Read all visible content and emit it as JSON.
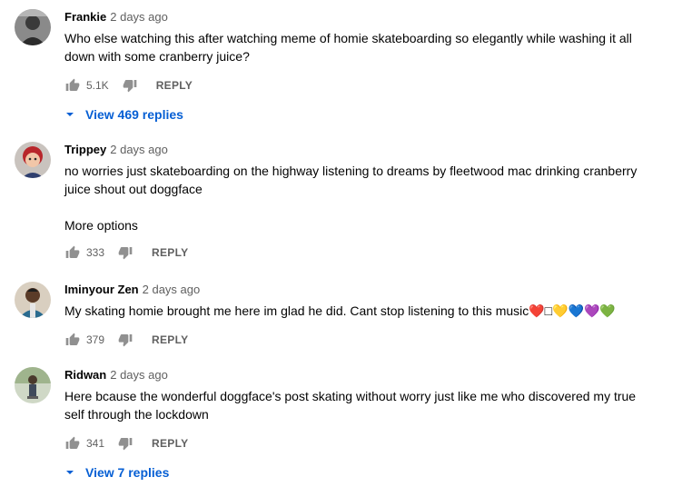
{
  "comments": [
    {
      "author": "Frankie",
      "time": "2 days ago",
      "lines": [
        "Who else watching this after watching meme of homie skateboarding so elegantly while washing it all",
        "down with some cranberry juice?"
      ],
      "likes": "5.1K",
      "reply_label": "REPLY",
      "view_replies": "View 469 replies"
    },
    {
      "author": "Trippey",
      "time": "2 days ago",
      "lines": [
        "no worries just skateboarding on the highway listening to dreams by fleetwood mac drinking cranberry",
        "juice shout out doggface"
      ],
      "more": "More options",
      "likes": "333",
      "reply_label": "REPLY"
    },
    {
      "author": "Iminyour Zen",
      "time": "2 days ago",
      "lines": [
        "My skating homie brought me here im glad he did. Cant stop listening to this music❤️□💛💙💜💚"
      ],
      "likes": "379",
      "reply_label": "REPLY"
    },
    {
      "author": "Ridwan",
      "time": "2 days ago",
      "lines": [
        "Here bcause the wonderful doggface's post skating without worry just like me who discovered my true",
        "self through the lockdown"
      ],
      "likes": "341",
      "reply_label": "REPLY",
      "view_replies": "View 7 replies"
    }
  ],
  "icons": {
    "like": "thumbs-up-icon",
    "dislike": "thumbs-down-icon",
    "expand": "caret-down-icon"
  },
  "colors": {
    "link_blue": "#065fd4",
    "meta_gray": "#606060",
    "text": "#030303"
  }
}
